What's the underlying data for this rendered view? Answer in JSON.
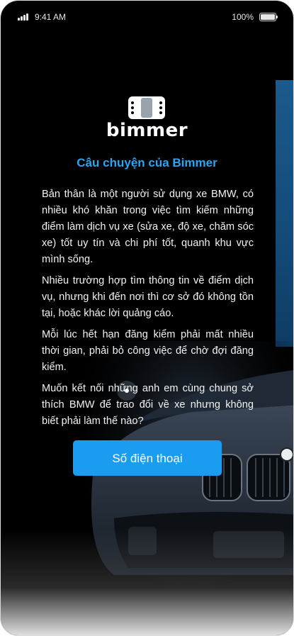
{
  "status_bar": {
    "time": "9:41 AM",
    "battery": "100%"
  },
  "brand": {
    "name": "bimmer"
  },
  "story": {
    "title": "Câu chuyện của Bimmer",
    "paragraphs": [
      "Bản thân là một người sử dụng xe BMW, có nhiều khó khăn trong việc tìm kiếm những điểm làm dịch vụ xe (sửa xe, độ xe, chăm sóc xe) tốt uy tín và chi phí tốt, quanh khu vực mình sống.",
      "Nhiều trường hợp tìm thông tin về điểm dịch vụ, nhưng khi đến nơi thì cơ sở đó không tồn tại, hoặc khác lời quảng cáo.",
      "Mỗi lúc hết hạn đăng kiểm phải mất nhiều thời gian, phải bỏ công việc để chờ đợi đăng kiểm.",
      "Muốn kết nối những anh em cùng chung sở thích BMW để trao đổi về xe nhưng không biết phải làm thế nào?"
    ]
  },
  "cta": {
    "label": "Số điện thoại"
  },
  "colors": {
    "accent": "#2aa6f4",
    "button": "#1a9df0",
    "background": "#000000"
  },
  "icons": {
    "logo": "bimmer-logo-icon",
    "signal": "signal-icon",
    "battery": "battery-icon"
  }
}
